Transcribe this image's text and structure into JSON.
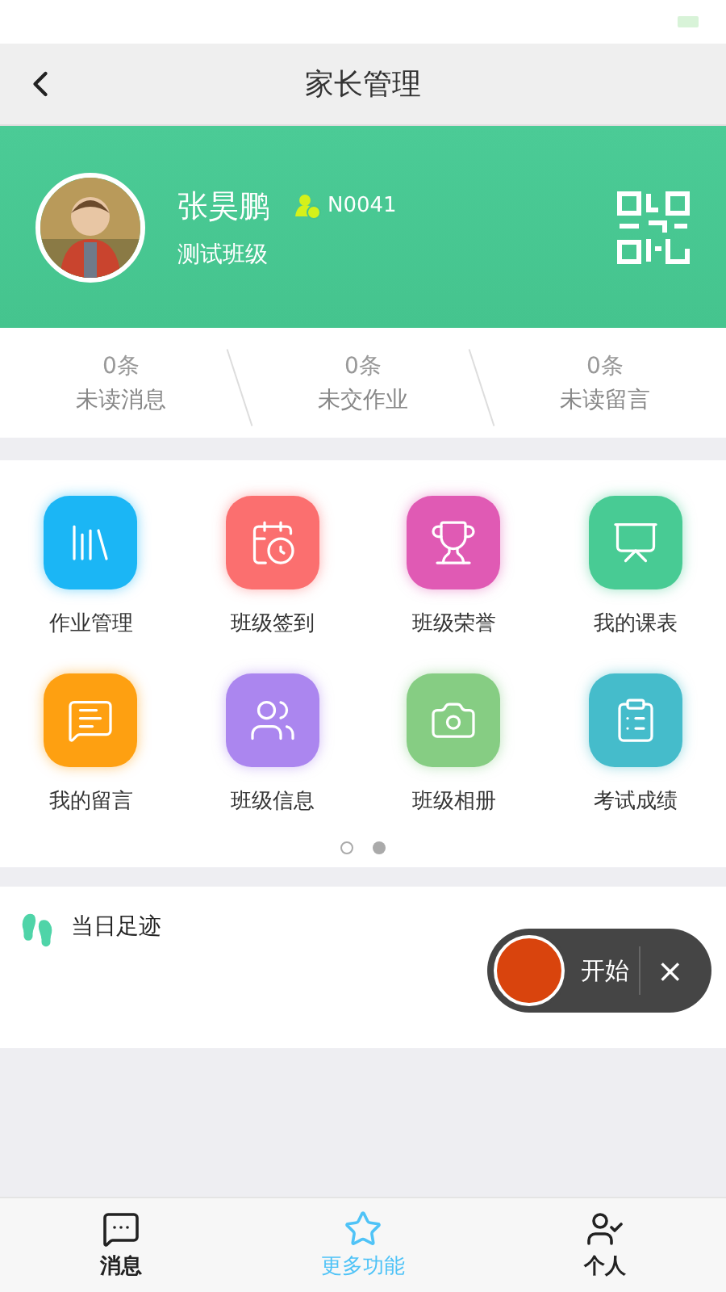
{
  "header": {
    "title": "家长管理"
  },
  "profile": {
    "name": "张昊鹏",
    "id": "N0041",
    "class": "测试班级"
  },
  "stats": [
    {
      "count": "0条",
      "label": "未读消息"
    },
    {
      "count": "0条",
      "label": "未交作业"
    },
    {
      "count": "0条",
      "label": "未读留言"
    }
  ],
  "features": [
    {
      "label": "作业管理",
      "color": "#1bb6f5"
    },
    {
      "label": "班级签到",
      "color": "#fb6f6f"
    },
    {
      "label": "班级荣誉",
      "color": "#e05ab4"
    },
    {
      "label": "我的课表",
      "color": "#48cb94"
    },
    {
      "label": "我的留言",
      "color": "#fea011"
    },
    {
      "label": "班级信息",
      "color": "#ab86ef"
    },
    {
      "label": "班级相册",
      "color": "#86cd83"
    },
    {
      "label": "考试成绩",
      "color": "#45bccb"
    }
  ],
  "pager": [
    {
      "selected": false
    },
    {
      "selected": true
    }
  ],
  "footprint": {
    "title": "当日足迹"
  },
  "recorder": {
    "label": "开始",
    "close": "×"
  },
  "tabs": [
    {
      "label": "消息",
      "selected": false
    },
    {
      "label": "更多功能",
      "selected": true
    },
    {
      "label": "个人",
      "selected": false
    }
  ]
}
